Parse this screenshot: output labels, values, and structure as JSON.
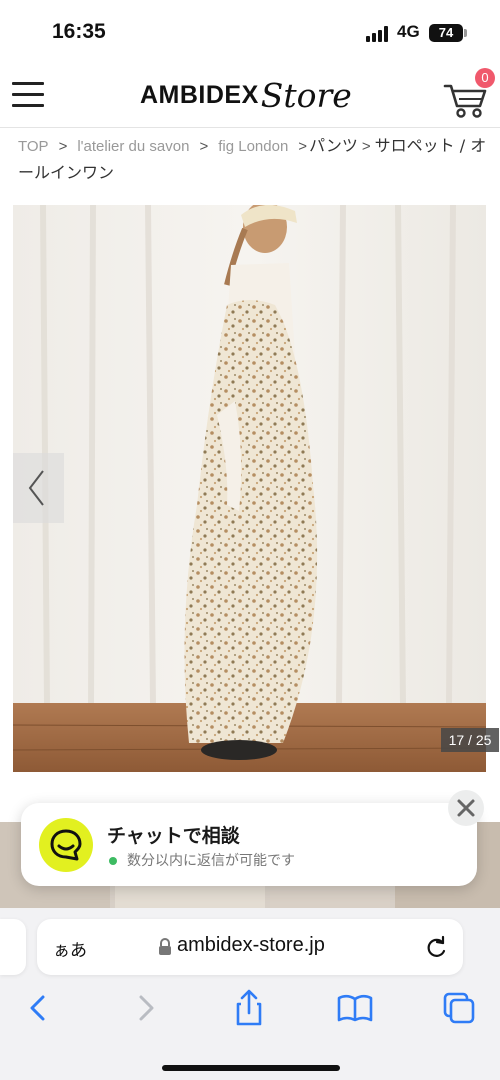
{
  "status_bar": {
    "time": "16:35",
    "network": "4G",
    "battery": "74"
  },
  "header": {
    "logo_main": "AMBIDEX",
    "logo_sub": "Store",
    "cart_count": "0"
  },
  "breadcrumb": {
    "items": [
      "TOP",
      "l'atelier du savon",
      "fig London",
      "パンツ",
      "サロペット / オールインワン"
    ],
    "separator": ">"
  },
  "product_image": {
    "counter": "17 / 25"
  },
  "chat": {
    "title": "チャットで相談",
    "status": "数分以内に返信が可能です",
    "accent_color": "#e2f020",
    "status_color": "#3dbb62"
  },
  "browser": {
    "text_size_label": "ぁあ",
    "url": "ambidex-store.jp"
  },
  "colors": {
    "badge": "#f0596c",
    "ios_blue": "#2f7cf6"
  },
  "icons": [
    "hamburger-icon",
    "cart-icon",
    "chevron-left-icon",
    "chat-bubble-icon",
    "close-icon",
    "lock-icon",
    "reload-icon",
    "back-icon",
    "forward-icon",
    "share-icon",
    "bookmarks-icon",
    "tabs-icon"
  ]
}
